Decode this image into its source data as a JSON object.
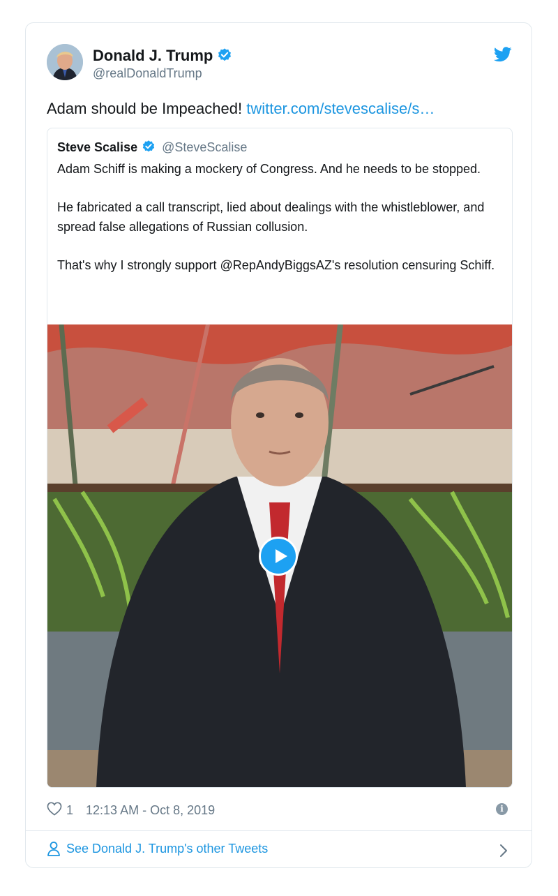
{
  "tweet": {
    "author_name": "Donald J. Trump",
    "author_handle": "@realDonaldTrump",
    "text": "Adam should be Impeached!",
    "link": "twitter.com/stevescalise/s…",
    "likes": "1",
    "timestamp": "12:13 AM - Oct 8, 2019",
    "footer_link": "See Donald J. Trump's other Tweets"
  },
  "quote": {
    "author_name": "Steve Scalise",
    "author_handle": "@SteveScalise",
    "paragraphs": [
      "Adam Schiff is making a mockery of Congress. And he needs to be stopped.",
      "He fabricated a call transcript, lied about dealings with the whistleblower, and spread false allegations of Russian collusion.",
      "That's why I strongly support @RepAndyBiggsAZ's resolution censuring Schiff."
    ]
  },
  "icons": {
    "verified": "verified-badge-icon",
    "brand": "twitter-bird-icon",
    "like": "heart-icon",
    "info": "info-icon",
    "profile": "person-icon",
    "chevron": "chevron-right-icon",
    "play": "play-icon"
  },
  "colors": {
    "accent": "#1da1f2",
    "link": "#1b95e0",
    "muted": "#657786",
    "border": "#e1e8ed"
  }
}
